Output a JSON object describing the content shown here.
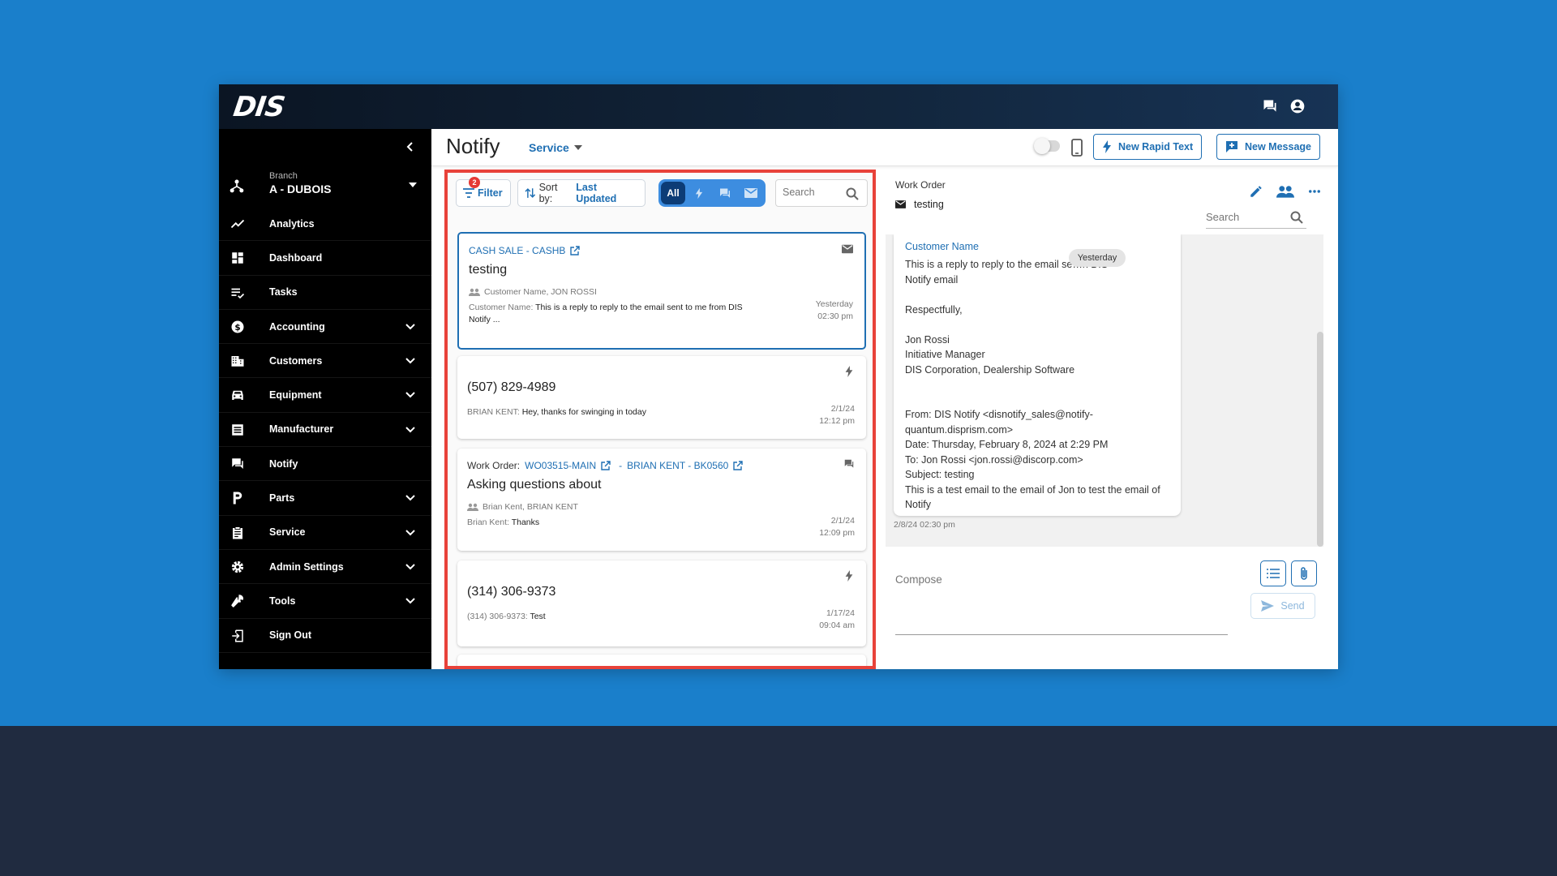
{
  "app": {
    "logo": "DIS"
  },
  "topbar": {
    "chat_icon": "chat-icon",
    "account_icon": "account-circle-icon"
  },
  "sidebar": {
    "branch_label": "Branch",
    "branch_value": "A - DUBOIS",
    "items": [
      {
        "label": "Analytics",
        "icon": "analytics-icon",
        "expandable": false
      },
      {
        "label": "Dashboard",
        "icon": "dashboard-icon",
        "expandable": false
      },
      {
        "label": "Tasks",
        "icon": "tasks-icon",
        "expandable": false
      },
      {
        "label": "Accounting",
        "icon": "dollar-icon",
        "expandable": true
      },
      {
        "label": "Customers",
        "icon": "building-icon",
        "expandable": true
      },
      {
        "label": "Equipment",
        "icon": "car-icon",
        "expandable": true
      },
      {
        "label": "Manufacturer",
        "icon": "list-icon",
        "expandable": true
      },
      {
        "label": "Notify",
        "icon": "chat-icon",
        "expandable": false
      },
      {
        "label": "Parts",
        "icon": "parts-icon",
        "expandable": true
      },
      {
        "label": "Service",
        "icon": "clipboard-icon",
        "expandable": true
      },
      {
        "label": "Admin Settings",
        "icon": "gear-icon",
        "expandable": true
      },
      {
        "label": "Tools",
        "icon": "wrench-icon",
        "expandable": true
      },
      {
        "label": "Sign Out",
        "icon": "sign-out-icon",
        "expandable": false
      }
    ]
  },
  "header": {
    "title": "Notify",
    "dropdown": "Service",
    "new_rapid_text": "New Rapid Text",
    "new_message": "New Message"
  },
  "list": {
    "filter_label": "Filter",
    "filter_badge": "2",
    "sort_prefix": "Sort by:",
    "sort_value": "Last Updated",
    "seg_all": "All",
    "search_placeholder": "Search",
    "cards": [
      {
        "link": "CASH SALE - CASHB",
        "title": "testing",
        "participants": "Customer Name, JON ROSSI",
        "sender": "Customer Name:",
        "message": "This is a reply to reply to the email sent to me from DIS Notify ...",
        "date": "Yesterday",
        "time": "02:30 pm",
        "type": "email"
      },
      {
        "title": "(507) 829-4989",
        "sender": "BRIAN KENT:",
        "message": "Hey, thanks for swinging in today",
        "date": "2/1/24",
        "time": "12:12 pm",
        "type": "rapid-text"
      },
      {
        "wo_label": "Work Order:",
        "wo_link": "WO03515-MAIN",
        "sep": "-",
        "person_link": "BRIAN KENT - BK0560",
        "title": "Asking questions about",
        "participants": "Brian Kent, BRIAN KENT",
        "sender": "Brian Kent:",
        "message": "Thanks",
        "date": "2/1/24",
        "time": "12:09 pm",
        "type": "chat"
      },
      {
        "title": "(314) 306-9373",
        "sender": "(314) 306-9373:",
        "message": "Test",
        "date": "1/17/24",
        "time": "09:04 am",
        "type": "rapid-text"
      }
    ]
  },
  "detail": {
    "work_order_label": "Work Order",
    "subject": "testing",
    "search_placeholder": "Search",
    "from_name": "Customer  Name",
    "date_chip": "Yesterday",
    "body": "This is a reply to reply to the email se…n DIS\nNotify email\n\nRespectfully,\n\nJon Rossi\nInitiative Manager\nDIS Corporation, Dealership Software\n\n\nFrom: DIS Notify <disnotify_sales@notify-quantum.disprism.com>\nDate: Thursday, February 8, 2024 at 2:29 PM\nTo: Jon Rossi <jon.rossi@discorp.com>\nSubject: testing\nThis is a test email to the email of Jon to test the email of Notify",
    "timestamp": "2/8/24 02:30 pm",
    "compose_placeholder": "Compose",
    "send_label": "Send"
  },
  "colors": {
    "accent": "#1f6fb3",
    "highlight": "#e8423a",
    "sidebar": "#000000",
    "background": "#1a7fcb"
  }
}
